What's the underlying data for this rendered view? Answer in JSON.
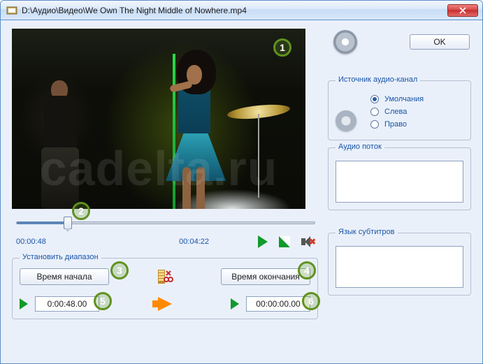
{
  "window": {
    "title": "D:\\Аудио\\Видео\\We Own The Night Middle of Nowhere.mp4"
  },
  "video": {
    "watermark": "cadelta.ru"
  },
  "time": {
    "current": "00:00:48",
    "total": "00:04:22"
  },
  "range": {
    "group": "Установить диапазон",
    "start_btn": "Время начала",
    "end_btn": "Время окончания",
    "start_value": "0:00:48.00",
    "end_value": "00:00:00.00"
  },
  "right": {
    "ok": "OK",
    "audio_source_group": "Источник аудио-канал",
    "radios": {
      "default": "Умолчания",
      "left": "Слева",
      "right": "Право"
    },
    "stream_group": "Аудио поток",
    "sub_group": "Язык субтитров"
  },
  "callouts": {
    "c1": "1",
    "c2": "2",
    "c3": "3",
    "c4": "4",
    "c5": "5",
    "c6": "6"
  }
}
